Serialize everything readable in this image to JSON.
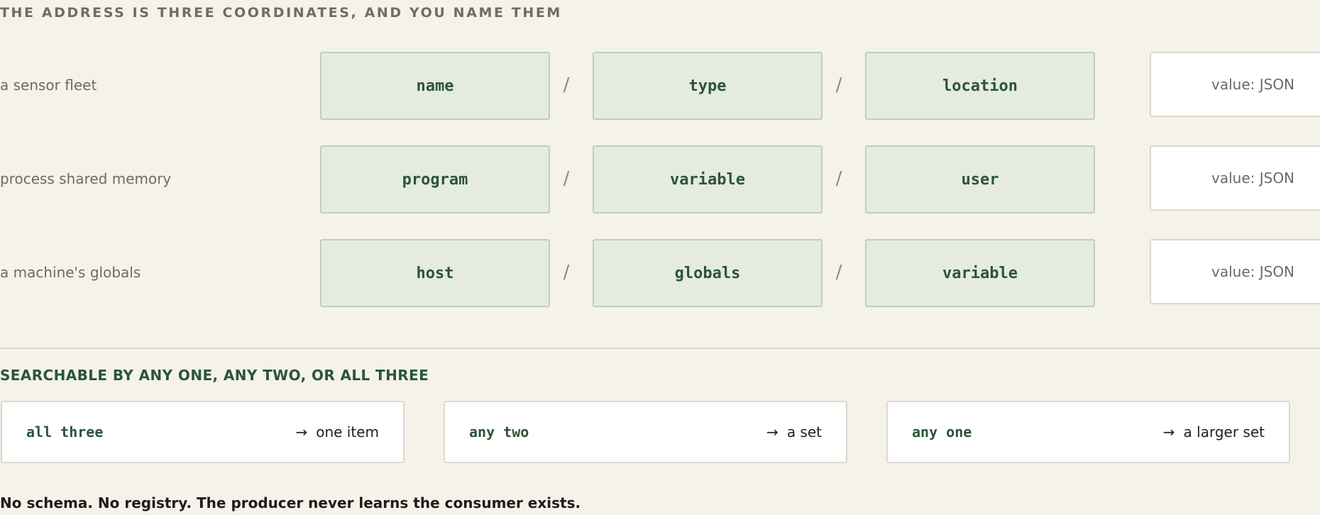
{
  "heading": "THE ADDRESS IS THREE COORDINATES, AND YOU NAME THEM",
  "rows": [
    {
      "label": "a sensor fleet",
      "coords": [
        "name",
        "type",
        "location"
      ],
      "value": "value: JSON"
    },
    {
      "label": "process shared memory",
      "coords": [
        "program",
        "variable",
        "user"
      ],
      "value": "value: JSON"
    },
    {
      "label": "a machine's globals",
      "coords": [
        "host",
        "globals",
        "variable"
      ],
      "value": "value: JSON"
    }
  ],
  "separator": "/",
  "search": {
    "heading": "SEARCHABLE BY ANY ONE, ANY TWO, OR ALL THREE",
    "arrow": "→",
    "cards": [
      {
        "key": "all three",
        "result": "one item"
      },
      {
        "key": "any two",
        "result": "a set"
      },
      {
        "key": "any one",
        "result": "a larger set"
      }
    ]
  },
  "footer": "No schema. No registry. The producer never learns the consumer exists.",
  "colors": {
    "background": "#f5f2ea",
    "coord_fill": "#e5ebdf",
    "coord_border": "#bcd0bd",
    "accent_green": "#2c5538"
  }
}
